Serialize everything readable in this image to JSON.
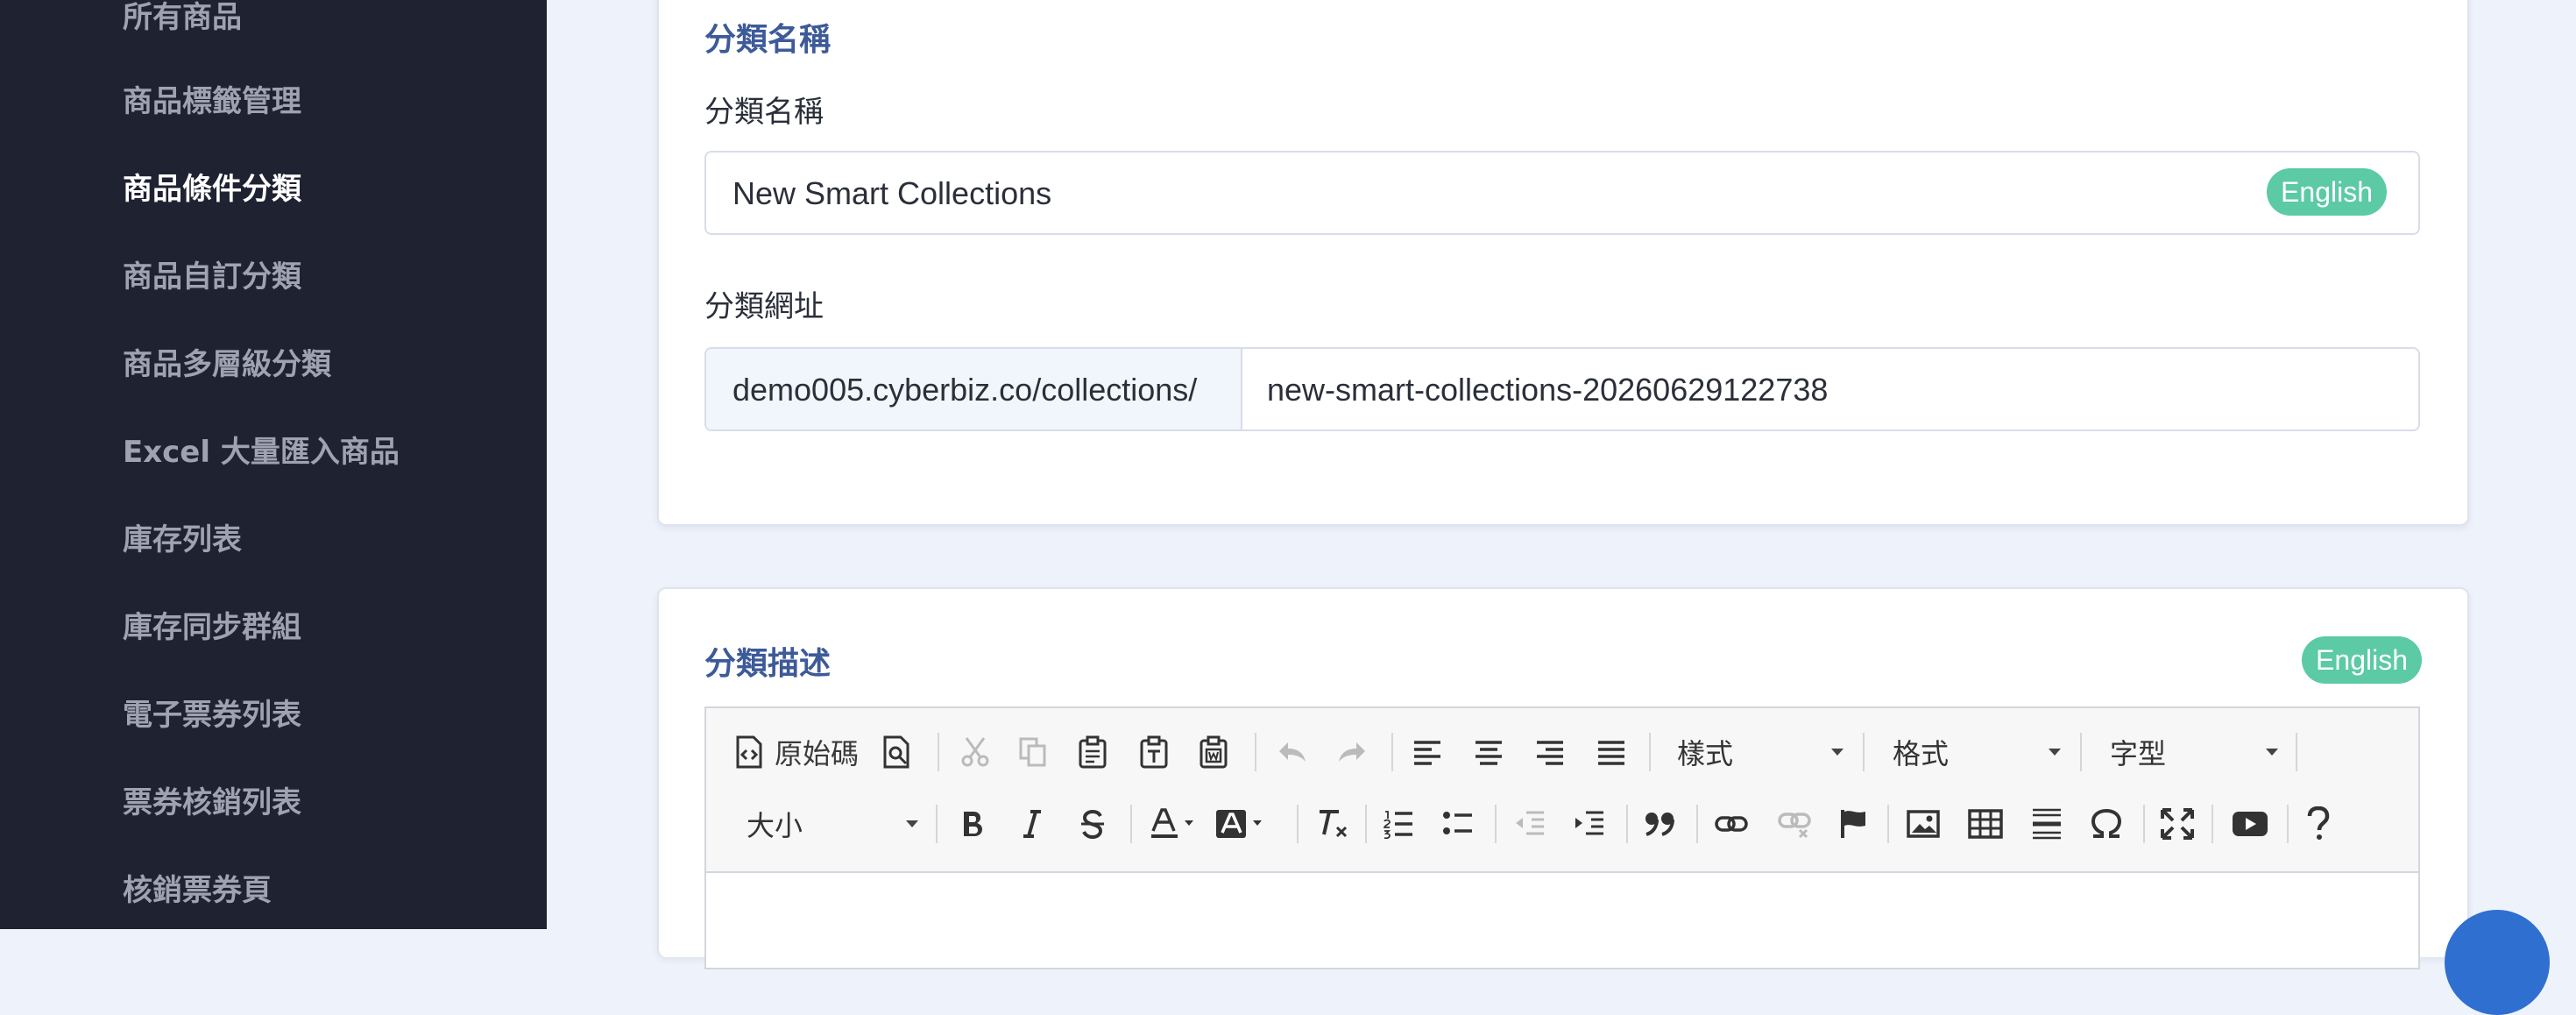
{
  "sidebar": {
    "items": [
      {
        "label": "所有商品",
        "active": false
      },
      {
        "label": "商品標籤管理",
        "active": false
      },
      {
        "label": "商品條件分類",
        "active": true
      },
      {
        "label": "商品自訂分類",
        "active": false
      },
      {
        "label": "商品多層級分類",
        "active": false
      },
      {
        "label": "Excel 大量匯入商品",
        "active": false
      },
      {
        "label": "庫存列表",
        "active": false
      },
      {
        "label": "庫存同步群組",
        "active": false
      },
      {
        "label": "電子票券列表",
        "active": false
      },
      {
        "label": "票券核銷列表",
        "active": false
      },
      {
        "label": "核銷票券頁",
        "active": false
      }
    ]
  },
  "name_card": {
    "title": "分類名稱",
    "name_label": "分類名稱",
    "name_value": "New Smart Collections",
    "lang_badge": "English",
    "url_label": "分類網址",
    "url_prefix": "demo005.cyberbiz.co/collections/",
    "url_value": "new-smart-collections-20260629122738"
  },
  "desc_card": {
    "title": "分類描述",
    "lang_badge": "English",
    "toolbar": {
      "source_label": "原始碼",
      "style_label": "樣式",
      "format_label": "格式",
      "font_label": "字型",
      "size_label": "大小"
    }
  },
  "colors": {
    "sidebar_bg": "#1f2231",
    "accent_title": "#3d5a99",
    "badge_green": "#5ccaa4",
    "page_bg": "#eef2fb"
  }
}
